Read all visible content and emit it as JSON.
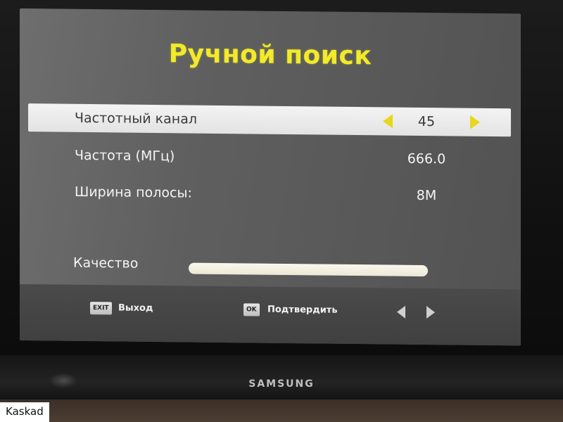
{
  "menu": {
    "title": "Ручной поиск"
  },
  "rows": [
    {
      "label": "Частотный канал",
      "value": "45",
      "selected": true
    },
    {
      "label": "Частота (МГц)",
      "value": "666.0",
      "selected": false
    },
    {
      "label": "Ширина полосы:",
      "value": "8M",
      "selected": false
    }
  ],
  "quality": {
    "label": "Качество",
    "level_percent": 100
  },
  "footer": {
    "exit_key": "EXIT",
    "exit_label": "Выход",
    "ok_key": "OK",
    "ok_label": "Подтвердить"
  },
  "tv": {
    "brand": "SAMSUNG"
  },
  "watermark": "Kaskad",
  "colors": {
    "title": "#f2ea2a",
    "selector_arrows": "#e6d81b",
    "selected_row_bg": "#ececec",
    "osd_background": "#5f5f5f"
  },
  "icons": {
    "channel_prev": "triangle-left",
    "channel_next": "triangle-right",
    "nav_prev": "triangle-left",
    "nav_next": "triangle-right"
  }
}
